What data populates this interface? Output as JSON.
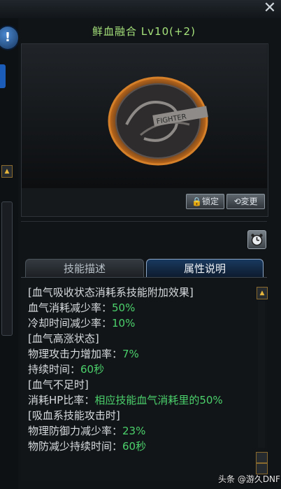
{
  "skill": {
    "title": "鲜血融合 Lv10(+2)"
  },
  "buttons": {
    "lock_label": "锁定",
    "change_label": "変更",
    "close_label": "✕"
  },
  "tabs": [
    {
      "label": "技能描述",
      "active": false
    },
    {
      "label": "属性说明",
      "active": true
    }
  ],
  "attributes": [
    {
      "text": "[血气吸收状态消耗系技能附加效果]"
    },
    {
      "label": "血气消耗减少率：",
      "value": "50%"
    },
    {
      "label": "冷却时间减少率：",
      "value": "10%"
    },
    {
      "text": "[血气高涨状态]"
    },
    {
      "label": "物理攻击力增加率：",
      "value": "7%"
    },
    {
      "label": "持续时间：",
      "value": "60秒"
    },
    {
      "text": "[血气不足时]"
    },
    {
      "label": "消耗HP比率：",
      "value": "相应技能血气消耗里的50%"
    },
    {
      "text": "[吸血系技能攻击时]"
    },
    {
      "label": "物理防御力减少率：",
      "value": "23%"
    },
    {
      "label": "物防减少持续时间：",
      "value": "60秒"
    }
  ],
  "watermark": "头条 @游久DNF",
  "colors": {
    "title": "#a5e27b",
    "value": "#4bd16b",
    "text": "#d8dcdf",
    "active_tab": "#19395f"
  },
  "icons": [
    "close-icon",
    "alert-icon",
    "lock-icon",
    "refresh-icon",
    "clock-icon",
    "game-logo-icon"
  ]
}
